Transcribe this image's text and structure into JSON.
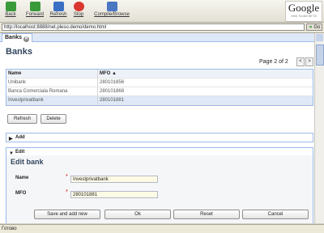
{
  "toolbar": {
    "back": "Back",
    "forward": "Forward",
    "refresh": "Refresh",
    "stop": "Stop",
    "compile": "Compile/Browse"
  },
  "logo": {
    "text": "Google",
    "sub": "Web Toolkit BETA"
  },
  "address": {
    "url": "http://localhost:8888/net.pleso.demo/demo.html",
    "go": "Go"
  },
  "tab": {
    "label": "Banks"
  },
  "banks": {
    "title": "Banks",
    "pager": "Page 2 of 2",
    "prev": "<",
    "next": ">",
    "columns": [
      "Name",
      "MFO ▲"
    ],
    "rows": [
      {
        "name": "Unibank",
        "mfo": "280101856"
      },
      {
        "name": "Banca Comerciala Romana",
        "mfo": "280101868"
      },
      {
        "name": "Investprivatbank",
        "mfo": "280101881"
      }
    ],
    "refresh": "Refresh",
    "delete": "Delete"
  },
  "add_section": {
    "label": "Add"
  },
  "edit_section": {
    "label": "Edit"
  },
  "edit_form": {
    "title": "Edit bank",
    "name_label": "Name",
    "name_value": "Investprivatbank",
    "mfo_label": "MFO",
    "mfo_value": "280101881",
    "save_add": "Save and add new",
    "ok": "Ok",
    "reset": "Reset",
    "cancel": "Cancel"
  },
  "status": {
    "text": "Готово"
  },
  "colors": {
    "accent": "#99bbe8",
    "header_text": "#33475e"
  }
}
